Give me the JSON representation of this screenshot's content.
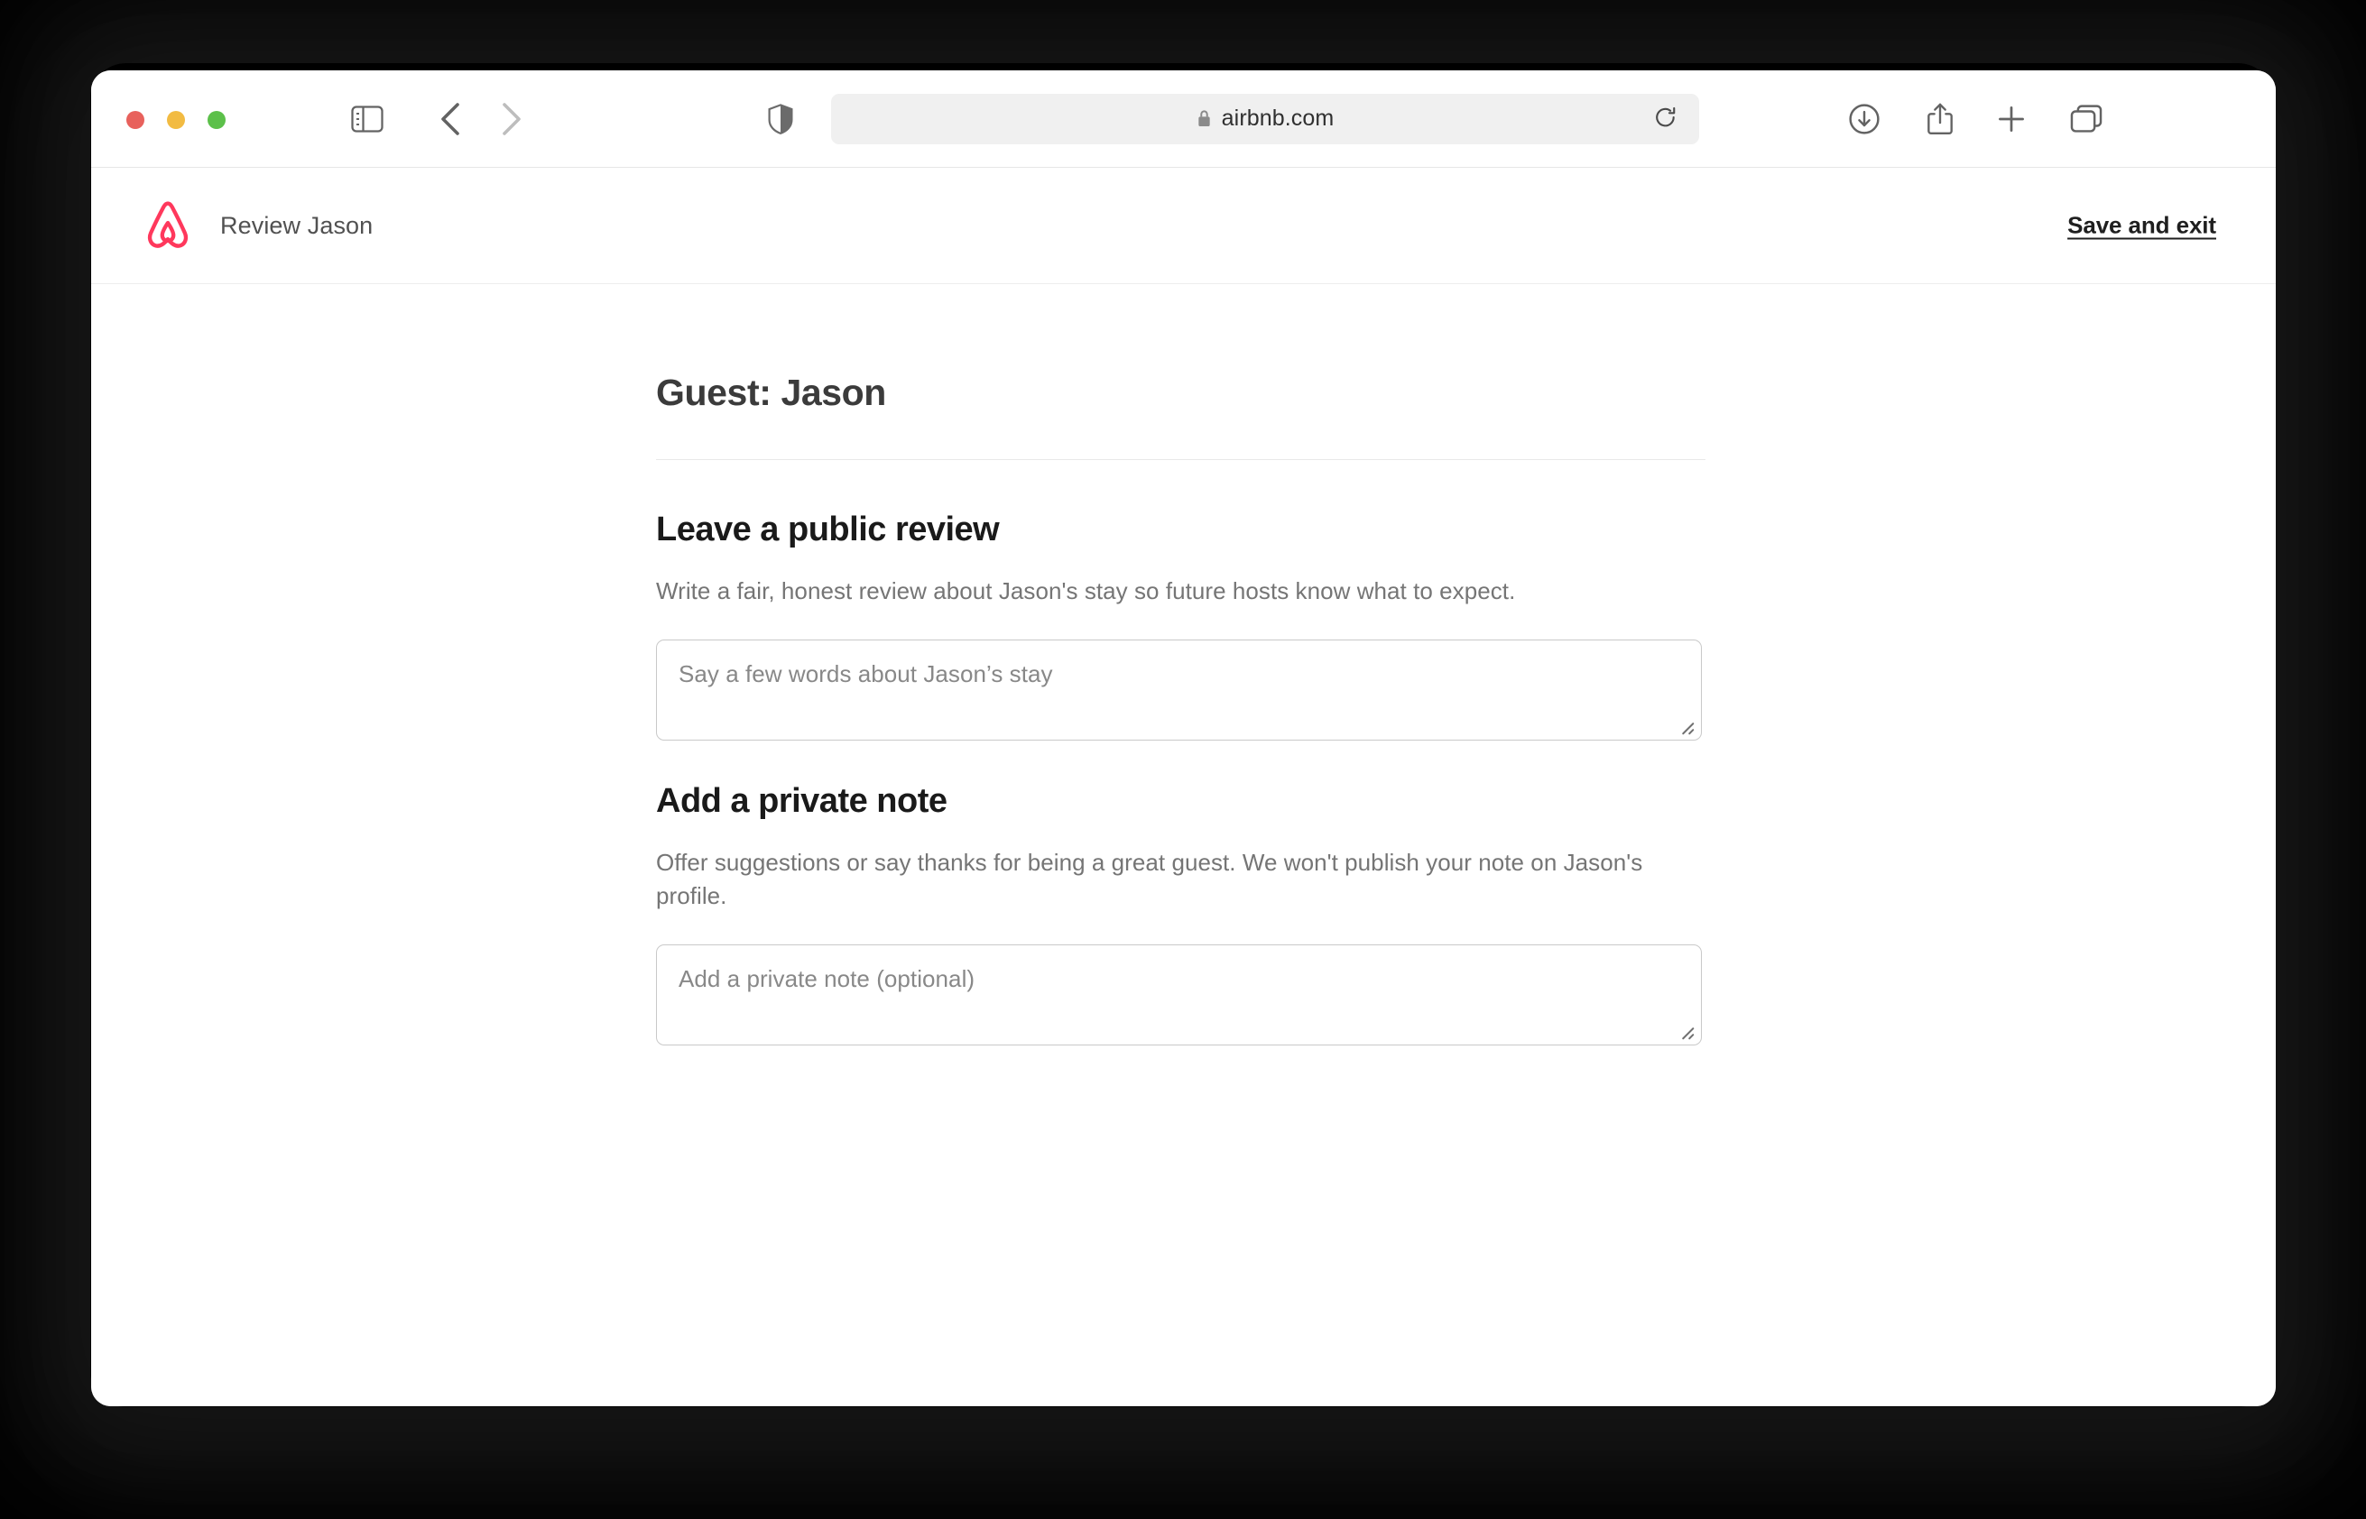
{
  "browser": {
    "window_controls": [
      {
        "name": "close",
        "color": "#e8615c"
      },
      {
        "name": "minimize",
        "color": "#f2bb42"
      },
      {
        "name": "zoom",
        "color": "#5cc04a"
      }
    ],
    "toolbar_icons": [
      {
        "name": "sidebar-toggle-icon"
      },
      {
        "name": "back-icon"
      },
      {
        "name": "forward-icon"
      },
      {
        "name": "privacy-shield-icon"
      },
      {
        "name": "downloads-icon"
      },
      {
        "name": "share-icon"
      },
      {
        "name": "new-tab-icon"
      },
      {
        "name": "tab-overview-icon"
      }
    ],
    "address_bar": {
      "url": "airbnb.com",
      "lock_icon": "lock-icon",
      "reload_icon": "reload-icon"
    }
  },
  "header": {
    "logo": "airbnb-belo-logo",
    "logo_color": "#FF385C",
    "title": "Review Jason",
    "save_exit_label": "Save and exit"
  },
  "main": {
    "guest_title": "Guest: Jason",
    "sections": [
      {
        "title": "Leave a public review",
        "description": "Write a fair, honest review about Jason's stay so future hosts know what to expect.",
        "input_placeholder": "Say a few words about Jason’s stay",
        "input_value": ""
      },
      {
        "title": "Add a private note",
        "description": "Offer suggestions or say thanks for being a great guest. We won't publish your note on Jason's profile.",
        "input_placeholder": "Add a private note (optional)",
        "input_value": ""
      }
    ]
  }
}
